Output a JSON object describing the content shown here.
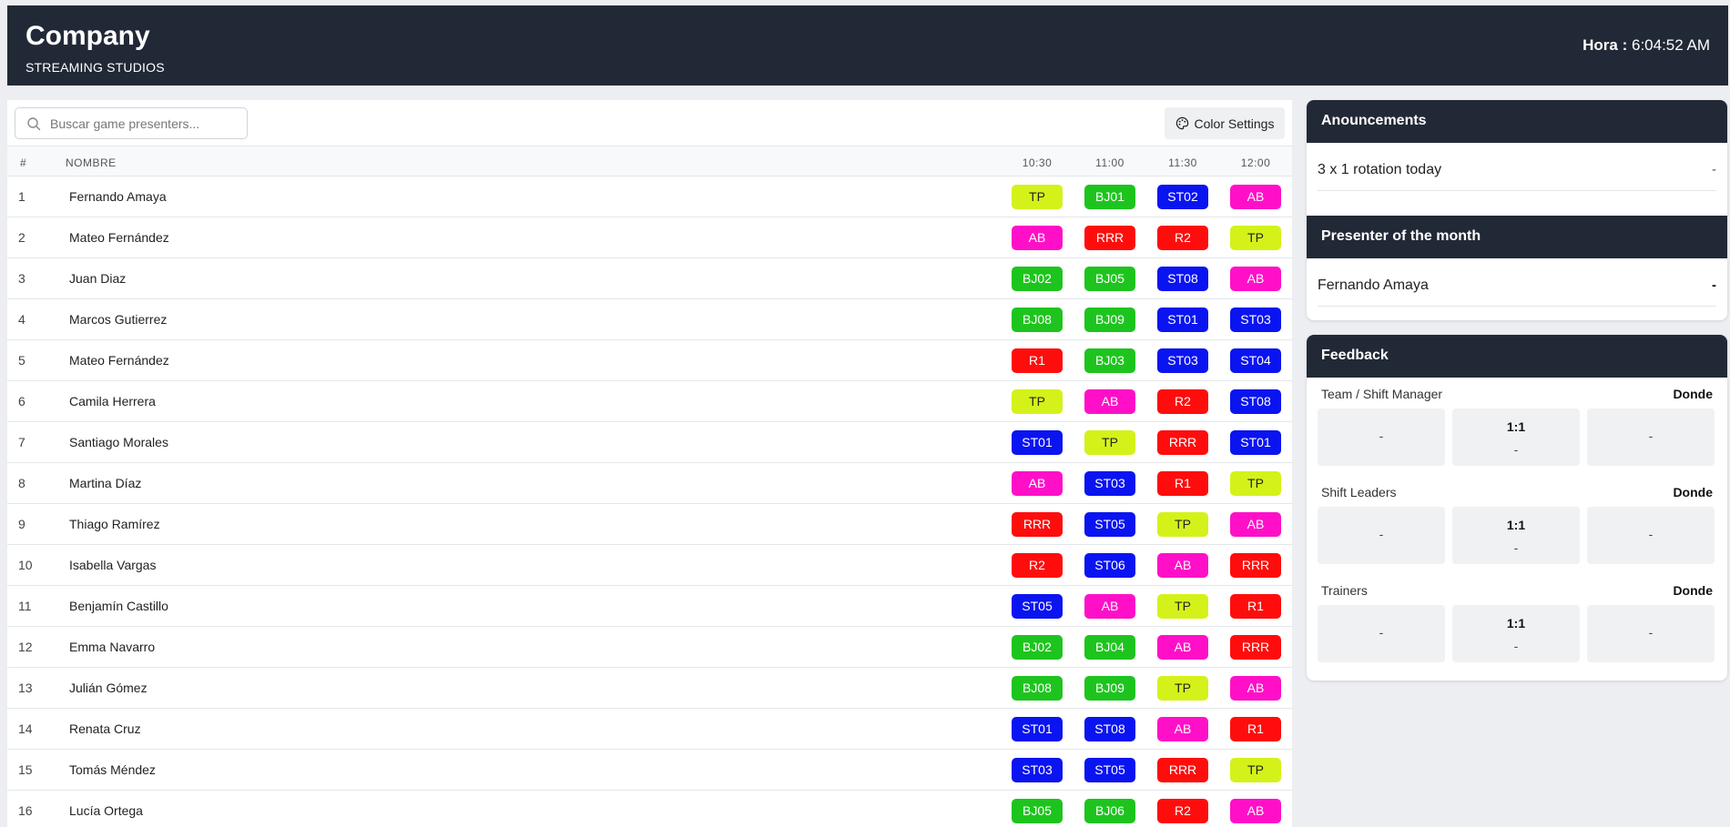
{
  "header": {
    "company": "Company",
    "subtitle": "STREAMING STUDIOS",
    "clock_label": "Hora :",
    "clock_value": "6:04:52 AM"
  },
  "toolbar": {
    "search_placeholder": "Buscar game presenters...",
    "search_icon": "search-icon",
    "color_settings_label": "Color Settings",
    "color_settings_icon": "palette-icon"
  },
  "table": {
    "col_num": "#",
    "col_name": "NOMBRE",
    "times": [
      "10:30",
      "11:00",
      "11:30",
      "12:00"
    ],
    "rows": [
      {
        "num": "1",
        "name": "Fernando Amaya",
        "slots": [
          "TP",
          "BJ01",
          "ST02",
          "AB"
        ]
      },
      {
        "num": "2",
        "name": "Mateo Fernández",
        "slots": [
          "AB",
          "RRR",
          "R2",
          "TP"
        ]
      },
      {
        "num": "3",
        "name": "Juan Diaz",
        "slots": [
          "BJ02",
          "BJ05",
          "ST08",
          "AB"
        ]
      },
      {
        "num": "4",
        "name": "Marcos Gutierrez",
        "slots": [
          "BJ08",
          "BJ09",
          "ST01",
          "ST03"
        ]
      },
      {
        "num": "5",
        "name": "Mateo Fernández",
        "slots": [
          "R1",
          "BJ03",
          "ST03",
          "ST04"
        ]
      },
      {
        "num": "6",
        "name": "Camila Herrera",
        "slots": [
          "TP",
          "AB",
          "R2",
          "ST08"
        ]
      },
      {
        "num": "7",
        "name": "Santiago Morales",
        "slots": [
          "ST01",
          "TP",
          "RRR",
          "ST01"
        ]
      },
      {
        "num": "8",
        "name": "Martina Díaz",
        "slots": [
          "AB",
          "ST03",
          "R1",
          "TP"
        ]
      },
      {
        "num": "9",
        "name": "Thiago Ramírez",
        "slots": [
          "RRR",
          "ST05",
          "TP",
          "AB"
        ]
      },
      {
        "num": "10",
        "name": "Isabella Vargas",
        "slots": [
          "R2",
          "ST06",
          "AB",
          "RRR"
        ]
      },
      {
        "num": "11",
        "name": "Benjamín Castillo",
        "slots": [
          "ST05",
          "AB",
          "TP",
          "R1"
        ]
      },
      {
        "num": "12",
        "name": "Emma Navarro",
        "slots": [
          "BJ02",
          "BJ04",
          "AB",
          "RRR"
        ]
      },
      {
        "num": "13",
        "name": "Julián Gómez",
        "slots": [
          "BJ08",
          "BJ09",
          "TP",
          "AB"
        ]
      },
      {
        "num": "14",
        "name": "Renata Cruz",
        "slots": [
          "ST01",
          "ST08",
          "AB",
          "R1"
        ]
      },
      {
        "num": "15",
        "name": "Tomás Méndez",
        "slots": [
          "ST03",
          "ST05",
          "RRR",
          "TP"
        ]
      },
      {
        "num": "16",
        "name": "Lucía Ortega",
        "slots": [
          "BJ05",
          "BJ06",
          "R2",
          "AB"
        ]
      }
    ]
  },
  "colors": {
    "TP": {
      "bg": "#d4f21a",
      "fg": "#222222"
    },
    "AB": {
      "bg": "#ff10c8",
      "fg": "#ffffff"
    },
    "BJ": {
      "bg": "#1ec41e",
      "fg": "#ffffff"
    },
    "ST": {
      "bg": "#0a14f0",
      "fg": "#ffffff"
    },
    "R": {
      "bg": "#ff0d0d",
      "fg": "#ffffff"
    },
    "header_bg": "#222936"
  },
  "announcements": {
    "title": "Anouncements",
    "text": "3 x 1 rotation today",
    "dash": "-"
  },
  "presenter_of_month": {
    "title": "Presenter of the month",
    "name": "Fernando Amaya",
    "dash": "-"
  },
  "feedback": {
    "title": "Feedback",
    "sections": [
      {
        "label": "Team / Shift Manager",
        "donde": "Donde",
        "left": "-",
        "mid_top": "1:1",
        "mid_bottom": "-",
        "right": "-"
      },
      {
        "label": "Shift Leaders",
        "donde": "Donde",
        "left": "-",
        "mid_top": "1:1",
        "mid_bottom": "-",
        "right": "-"
      },
      {
        "label": "Trainers",
        "donde": "Donde",
        "left": "-",
        "mid_top": "1:1",
        "mid_bottom": "-",
        "right": "-"
      }
    ]
  }
}
